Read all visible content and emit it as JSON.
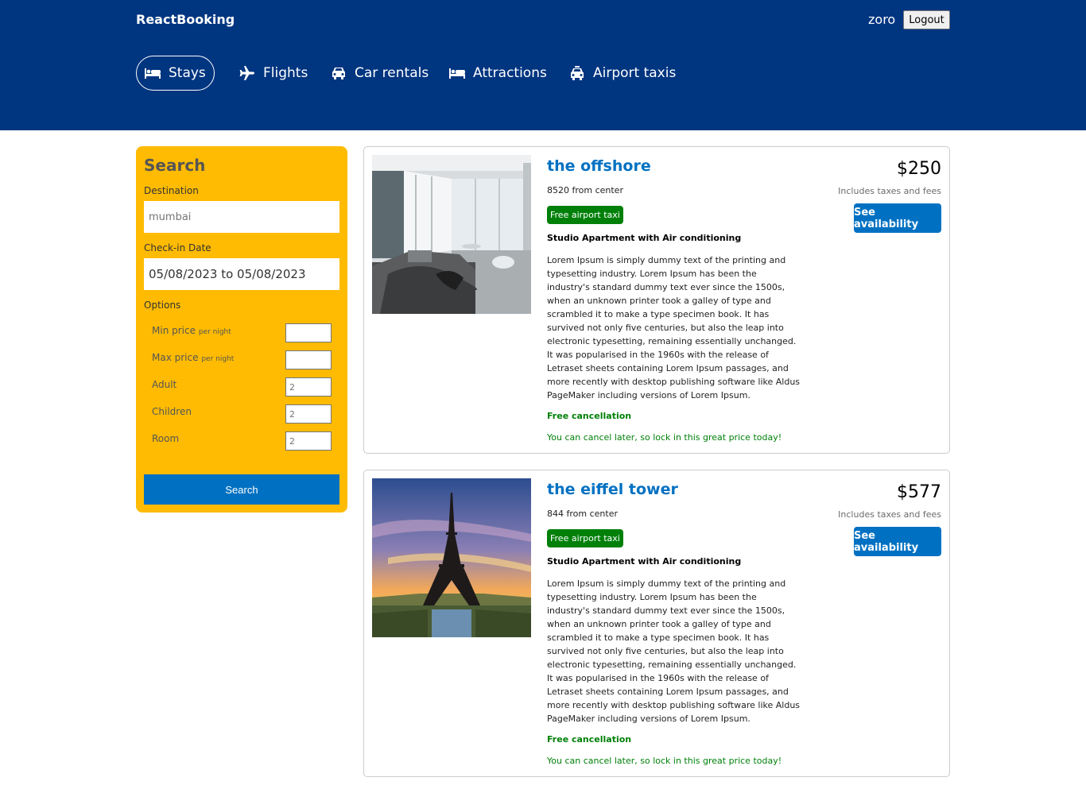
{
  "header": {
    "brand": "ReactBooking",
    "username": "zoro",
    "logout_label": "Logout",
    "bg_color": "#003580",
    "nav": [
      {
        "label": "Stays",
        "icon": "bed-icon",
        "active": true
      },
      {
        "label": "Flights",
        "icon": "plane-icon",
        "active": false
      },
      {
        "label": "Car rentals",
        "icon": "car-icon",
        "active": false
      },
      {
        "label": "Attractions",
        "icon": "bed-icon",
        "active": false
      },
      {
        "label": "Airport taxis",
        "icon": "taxi-icon",
        "active": false
      }
    ]
  },
  "search": {
    "title": "Search",
    "destination_label": "Destination",
    "destination_value": "mumbai",
    "checkin_label": "Check-in Date",
    "checkin_value": "05/08/2023 to 05/08/2023",
    "options_label": "Options",
    "options": [
      {
        "label": "Min price",
        "suffix": "per night",
        "value": ""
      },
      {
        "label": "Max price",
        "suffix": "per night",
        "value": ""
      },
      {
        "label": "Adult",
        "suffix": "",
        "value": "2"
      },
      {
        "label": "Children",
        "suffix": "",
        "value": "2"
      },
      {
        "label": "Room",
        "suffix": "",
        "value": "2"
      }
    ],
    "button_label": "Search",
    "panel_color": "#febb02"
  },
  "results": [
    {
      "title": "the offshore",
      "distance": "8520 from center",
      "taxi": "Free airport taxi",
      "subtitle": "Studio Apartment with Air conditioning",
      "description": "Lorem Ipsum is simply dummy text of the printing and typesetting industry. Lorem Ipsum has been the industry's standard dummy text ever since the 1500s, when an unknown printer took a galley of type and scrambled it to make a type specimen book. It has survived not only five centuries, but also the leap into electronic typesetting, remaining essentially unchanged. It was popularised in the 1960s with the release of Letraset sheets containing Lorem Ipsum passages, and more recently with desktop publishing software like Aldus PageMaker including versions of Lorem Ipsum.",
      "cancel": "Free cancellation",
      "cancel_sub": "You can cancel later, so lock in this great price today!",
      "price": "$250",
      "tax": "Includes taxes and fees",
      "button": "See availability",
      "image": "bedroom-photo"
    },
    {
      "title": "the eiffel tower",
      "distance": "844 from center",
      "taxi": "Free airport taxi",
      "subtitle": "Studio Apartment with Air conditioning",
      "description": "Lorem Ipsum is simply dummy text of the printing and typesetting industry. Lorem Ipsum has been the industry's standard dummy text ever since the 1500s, when an unknown printer took a galley of type and scrambled it to make a type specimen book. It has survived not only five centuries, but also the leap into electronic typesetting, remaining essentially unchanged. It was popularised in the 1960s with the release of Letraset sheets containing Lorem Ipsum passages, and more recently with desktop publishing software like Aldus PageMaker including versions of Lorem Ipsum.",
      "cancel": "Free cancellation",
      "cancel_sub": "You can cancel later, so lock in this great price today!",
      "price": "$577",
      "tax": "Includes taxes and fees",
      "button": "See availability",
      "image": "eiffel-tower-photo"
    }
  ],
  "colors": {
    "accent": "#0071c2",
    "green": "#008009"
  }
}
